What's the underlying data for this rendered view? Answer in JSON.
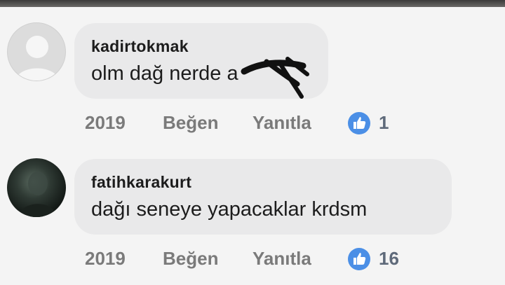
{
  "comments": [
    {
      "username": "kadirtokmak",
      "text": "olm dağ nerde a",
      "year": "2019",
      "like_label": "Beğen",
      "reply_label": "Yanıtla",
      "like_count": "1",
      "avatar": "default-avatar"
    },
    {
      "username": "fatihkarakurt",
      "text": "dağı seneye yapacaklar krdsm",
      "year": "2019",
      "like_label": "Beğen",
      "reply_label": "Yanıtla",
      "like_count": "16",
      "avatar": "profile-photo"
    }
  ],
  "colors": {
    "bubble": "#e9e9ea",
    "like_badge": "#4b8fe6",
    "action_text": "#7a7a7a"
  },
  "icons": [
    "thumbs-up-icon",
    "person-icon"
  ]
}
